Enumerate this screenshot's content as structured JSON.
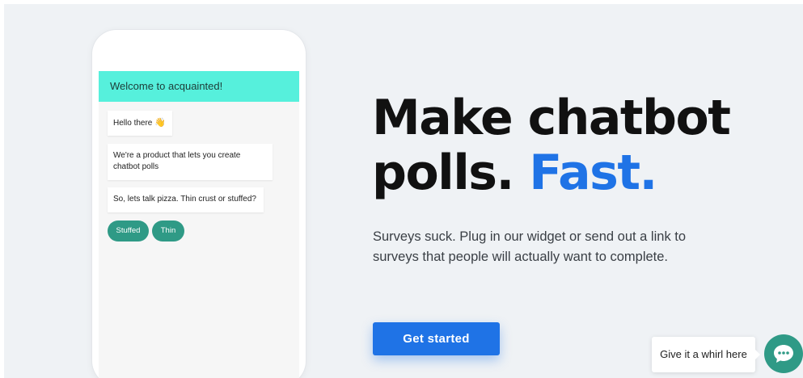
{
  "phone": {
    "header": "Welcome to acquainted!",
    "messages": [
      {
        "text": "Hello there",
        "emoji": "👋"
      },
      {
        "text": "We're a product that lets you create chatbot polls"
      },
      {
        "text": "So, lets talk pizza. Thin crust or stuffed?"
      }
    ],
    "replies": [
      "Stuffed",
      "Thin"
    ]
  },
  "hero": {
    "headline_part1": "Make chatbot polls.",
    "headline_accent": "Fast.",
    "subtext": "Surveys suck. Plug in our widget or send out a link to surveys that people will actually want to complete.",
    "cta_label": "Get started"
  },
  "widget": {
    "tooltip": "Give it a whirl here",
    "icon": "chat-bubble-icon"
  },
  "colors": {
    "accent": "#1f73e6",
    "teal": "#2f9a86",
    "header_mint": "#56f0dc",
    "background": "#eff2f5"
  }
}
